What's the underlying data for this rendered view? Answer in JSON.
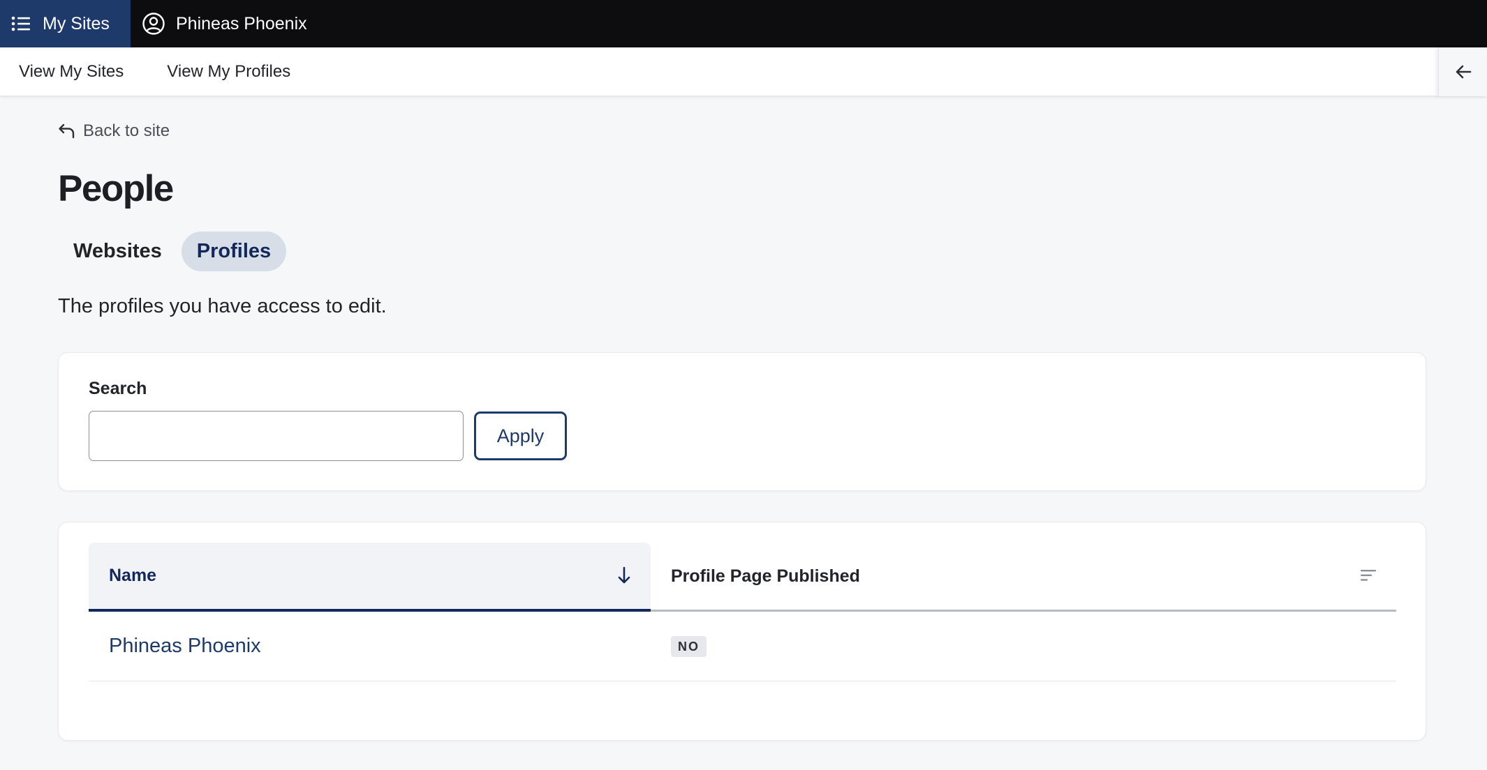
{
  "topbar": {
    "my_sites_label": "My Sites",
    "user_name": "Phineas Phoenix"
  },
  "subnav": {
    "items": [
      {
        "label": "View My Sites"
      },
      {
        "label": "View My Profiles"
      }
    ]
  },
  "back_link": "Back to site",
  "page_title": "People",
  "tabs": [
    {
      "label": "Websites",
      "active": false
    },
    {
      "label": "Profiles",
      "active": true
    }
  ],
  "description": "The profiles you have access to edit.",
  "search": {
    "label": "Search",
    "value": "",
    "apply_label": "Apply"
  },
  "table": {
    "columns": [
      {
        "label": "Name",
        "sorted": "descending"
      },
      {
        "label": "Profile Page Published"
      }
    ],
    "rows": [
      {
        "name": "Phineas Phoenix",
        "published": "NO"
      }
    ]
  },
  "colors": {
    "topbar_bg": "#0d0d0f",
    "accent": "#1d3a6b",
    "page_bg": "#f6f7f9",
    "active_tab_bg": "#d8dee8"
  }
}
